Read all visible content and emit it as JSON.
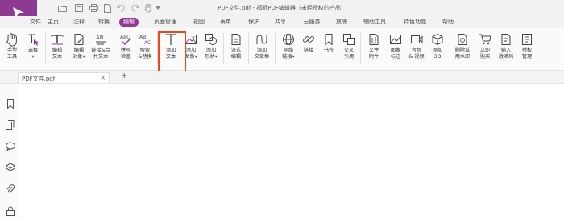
{
  "app": {
    "title": "PDF文件.pdf - 福昕PDF编辑器（未经授权的产品）",
    "accent": "#8e3a95"
  },
  "quick_access": [
    "folder-icon",
    "save-icon",
    "print-icon",
    "new-doc-icon",
    "undo-icon",
    "redo-icon",
    "hand-icon",
    "dropdown-icon"
  ],
  "tabs": [
    "文件",
    "主页",
    "注释",
    "转换",
    "编辑",
    "页面管理",
    "视图",
    "表单",
    "保护",
    "共享",
    "云服务",
    "放映",
    "辅助工具",
    "特色功能",
    "帮助"
  ],
  "active_tab": "编辑",
  "ribbon": {
    "tools": [
      {
        "label": "手型\n工具",
        "icon": "hand-tool-icon"
      },
      {
        "label": "选择\n▾",
        "icon": "select-icon"
      },
      {
        "label": "编辑\n文本",
        "icon": "edit-text-icon"
      },
      {
        "label": "编辑\n对象▾",
        "icon": "edit-object-icon"
      },
      {
        "label": "链接&合\n并文本",
        "icon": "link-merge-text-icon"
      },
      {
        "label": "拼写\n检查",
        "icon": "spell-check-icon"
      },
      {
        "label": "搜索\n&替换",
        "icon": "search-replace-icon"
      },
      {
        "label": "添加\n文本",
        "icon": "add-text-icon"
      },
      {
        "label": "添加\n图像▾",
        "icon": "add-image-icon"
      },
      {
        "label": "添加\n形状▾",
        "icon": "add-shape-icon"
      },
      {
        "label": "流式\n编辑",
        "icon": "flow-edit-icon"
      },
      {
        "label": "添加\n文章框",
        "icon": "add-article-box-icon"
      },
      {
        "label": "网络\n链接▾",
        "icon": "web-link-icon"
      },
      {
        "label": "链接",
        "icon": "link-icon"
      },
      {
        "label": "书签",
        "icon": "bookmark-icon"
      },
      {
        "label": "交叉\n引用",
        "icon": "cross-reference-icon"
      },
      {
        "label": "文件\n附件",
        "icon": "file-attachment-icon"
      },
      {
        "label": "图像\n标注",
        "icon": "image-annotation-icon"
      },
      {
        "label": "音频\n& 视频",
        "icon": "audio-video-icon"
      },
      {
        "label": "添加\n3D",
        "icon": "add-3d-icon"
      },
      {
        "label": "删除试\n用水印",
        "icon": "remove-watermark-icon"
      },
      {
        "label": "立即\n购买",
        "icon": "buy-now-icon"
      },
      {
        "label": "输入\n激活码",
        "icon": "activation-code-icon"
      },
      {
        "label": "授权\n管理",
        "icon": "license-manage-icon"
      }
    ]
  },
  "document_tab": {
    "name": "PDF文件.pdf",
    "close": "×"
  },
  "add_tab": "+",
  "sidebar": [
    "bookmark-panel-icon",
    "pages-panel-icon",
    "comments-panel-icon",
    "layers-panel-icon",
    "attachments-panel-icon",
    "security-panel-icon"
  ]
}
